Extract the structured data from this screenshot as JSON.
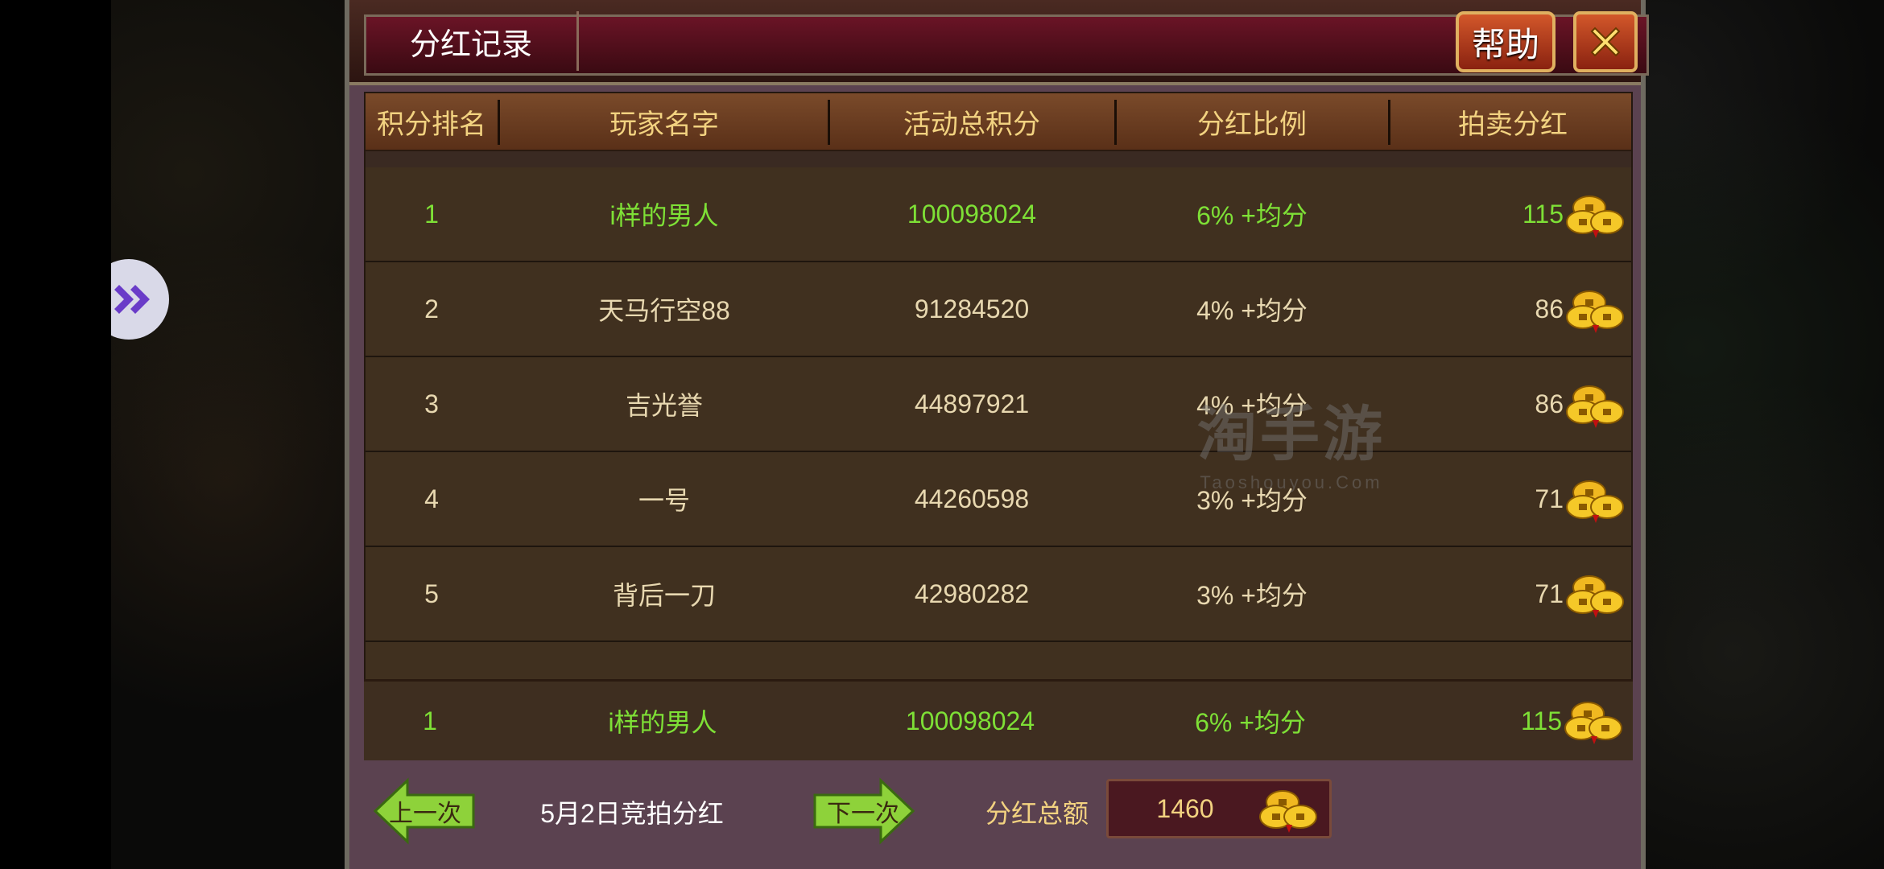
{
  "dialog": {
    "title": "分红记录",
    "help_label": "帮助"
  },
  "table": {
    "headers": [
      "积分排名",
      "玩家名字",
      "活动总积分",
      "分红比例",
      "拍卖分红"
    ],
    "rows": [
      {
        "rank": "1",
        "name": "i样的男人",
        "score": "100098024",
        "ratio": "6% +均分",
        "bonus": "115"
      },
      {
        "rank": "2",
        "name": "天马行空88",
        "score": "91284520",
        "ratio": "4% +均分",
        "bonus": "86"
      },
      {
        "rank": "3",
        "name": "吉光誉",
        "score": "44897921",
        "ratio": "4% +均分",
        "bonus": "86"
      },
      {
        "rank": "4",
        "name": "一号",
        "score": "44260598",
        "ratio": "3% +均分",
        "bonus": "71"
      },
      {
        "rank": "5",
        "name": "背后一刀",
        "score": "42980282",
        "ratio": "3% +均分",
        "bonus": "71"
      }
    ],
    "self_row": {
      "rank": "1",
      "name": "i样的男人",
      "score": "100098024",
      "ratio": "6% +均分",
      "bonus": "115"
    }
  },
  "watermark": {
    "cn": "淘手游",
    "en": "Taoshouyou.Com"
  },
  "footer": {
    "prev_label": "上一次",
    "date_label": "5月2日竞拍分红",
    "next_label": "下一次",
    "total_label": "分红总额",
    "total_value": "1460"
  },
  "colors": {
    "highlight_text": "#7ee036",
    "header_text": "#f2d280",
    "dialog_bg": "#5b4250"
  },
  "icons": [
    "forward-arrows-icon",
    "close-icon",
    "gold-coin-icon",
    "left-arrow-icon",
    "right-arrow-icon"
  ]
}
